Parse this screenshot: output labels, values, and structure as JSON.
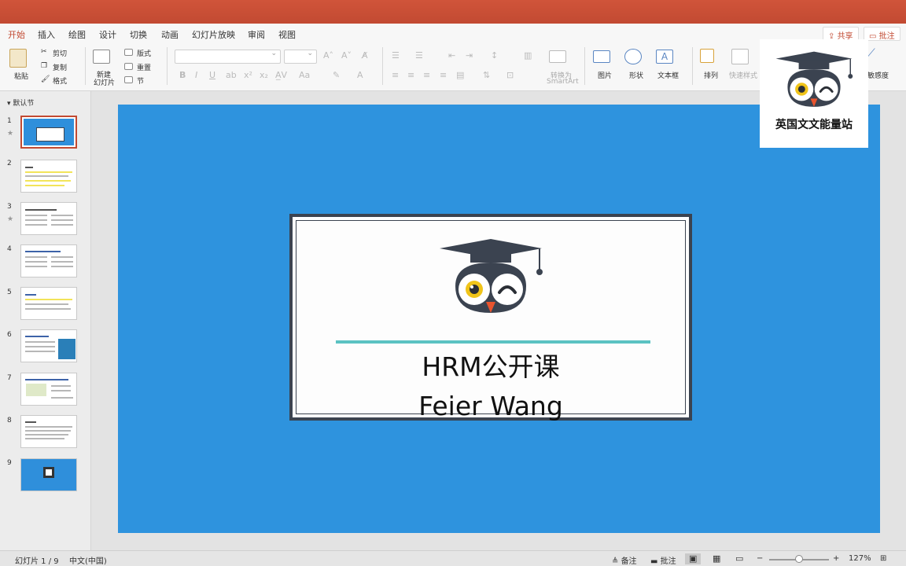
{
  "ribbon_tabs": [
    "开始",
    "插入",
    "绘图",
    "设计",
    "切换",
    "动画",
    "幻灯片放映",
    "审阅",
    "视图"
  ],
  "share_label": "共享",
  "comment_label": "批注",
  "ribbon": {
    "paste": "粘贴",
    "cut": "剪切",
    "copy": "复制",
    "format": "格式",
    "new_slide_line1": "新建",
    "new_slide_line2": "幻灯片",
    "layout": "版式",
    "reset": "重置",
    "section": "节",
    "smartart_line1": "转换为",
    "smartart_line2": "SmartArt",
    "picture": "图片",
    "shape": "形状",
    "textbox": "文本框",
    "arrange": "排列",
    "quick_styles": "快速样式",
    "sensitivity": "敏感度"
  },
  "sidebar": {
    "section_name": "默认节",
    "slide_numbers": [
      "1",
      "2",
      "3",
      "4",
      "5",
      "6",
      "7",
      "8",
      "9"
    ]
  },
  "slide": {
    "title": "HRM公开课",
    "subtitle": "Feier Wang"
  },
  "watermark": {
    "text": "英国文文能量站"
  },
  "statusbar": {
    "slide_position": "幻灯片 1 / 9",
    "language": "中文(中国)",
    "notes": "备注",
    "comments": "批注",
    "zoom": "127%"
  },
  "colors": {
    "accent": "#c24a32",
    "slide_bg": "#2e93de",
    "card_border": "#3b4350",
    "teal": "#5bc2c2"
  }
}
